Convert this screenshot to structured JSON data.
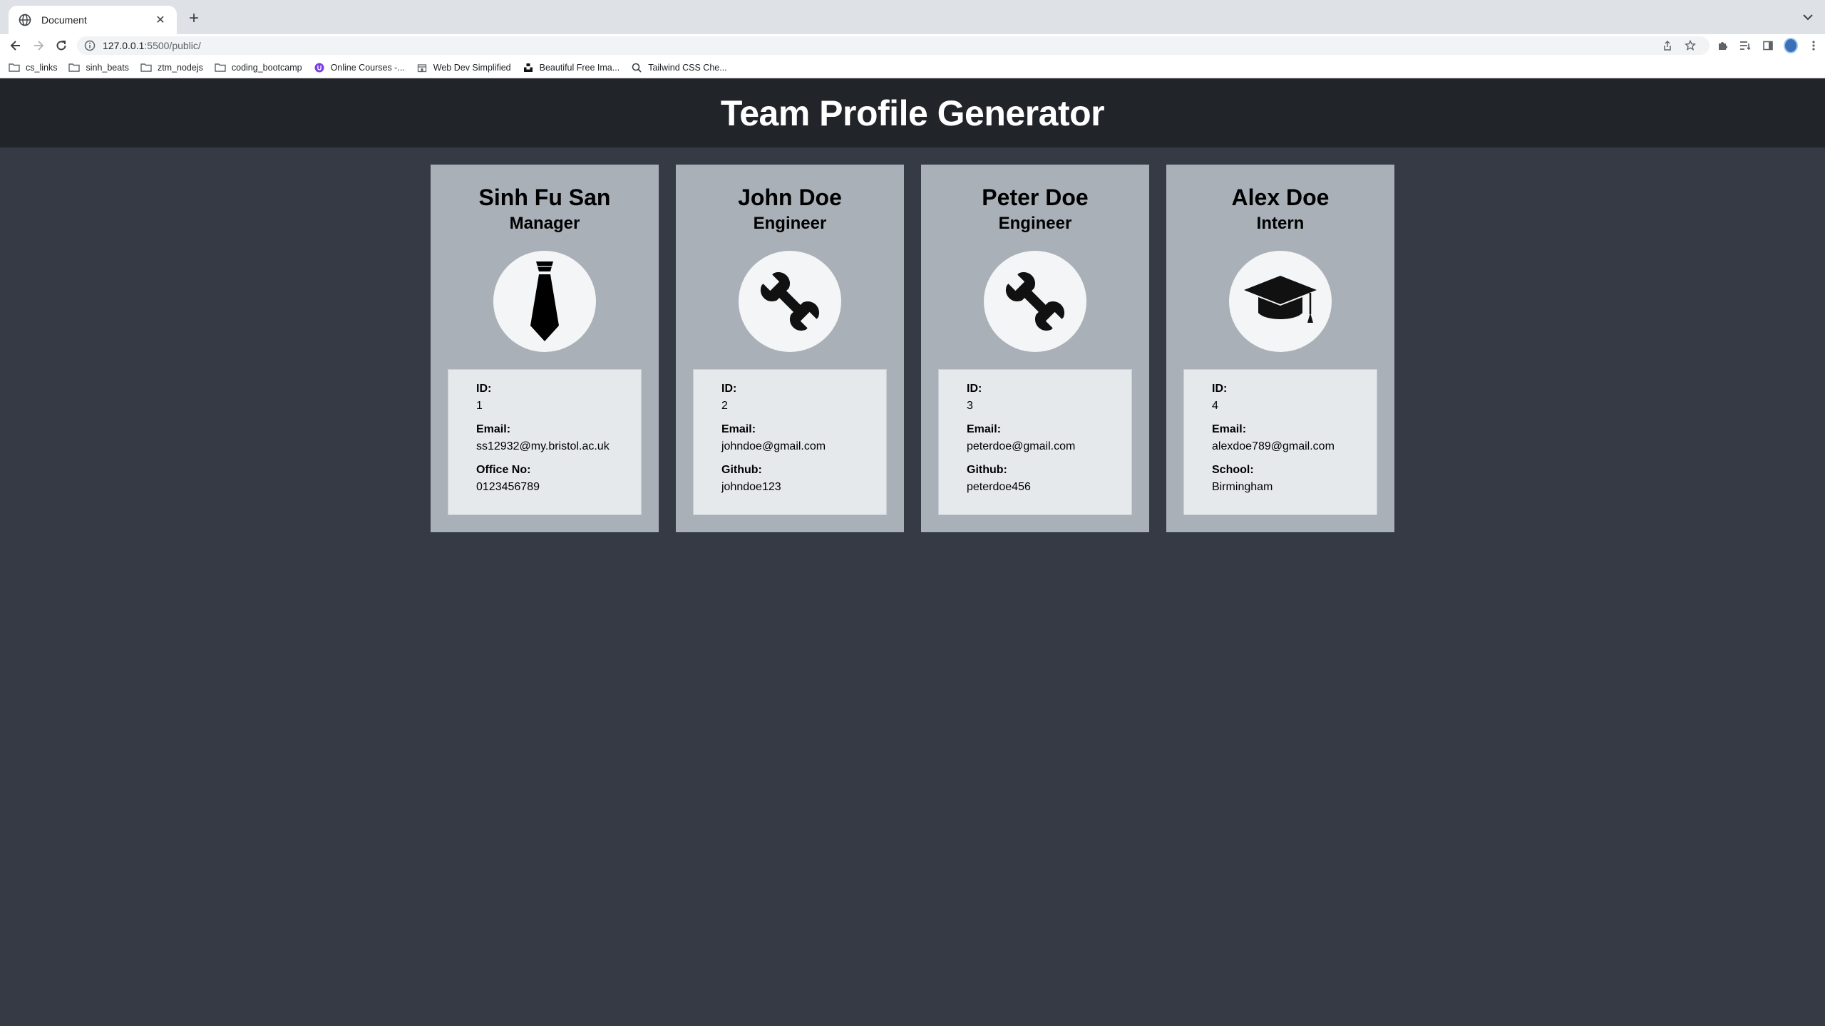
{
  "browser": {
    "tab_title": "Document",
    "url_host": "127.0.0.1",
    "url_path": ":5500/public/",
    "bookmarks": [
      {
        "label": "cs_links",
        "icon": "folder-icon"
      },
      {
        "label": "sinh_beats",
        "icon": "folder-icon"
      },
      {
        "label": "ztm_nodejs",
        "icon": "folder-icon"
      },
      {
        "label": "coding_bootcamp",
        "icon": "folder-icon"
      },
      {
        "label": "Online Courses -...",
        "icon": "course-icon"
      },
      {
        "label": "Web Dev Simplified",
        "icon": "store-icon"
      },
      {
        "label": "Beautiful Free Ima...",
        "icon": "unsplash-icon"
      },
      {
        "label": "Tailwind CSS Che...",
        "icon": "search-icon"
      }
    ]
  },
  "header": {
    "title": "Team Profile Generator"
  },
  "cards": [
    {
      "name": "Sinh Fu San",
      "role": "Manager",
      "icon": "tie-icon",
      "id_label": "ID:",
      "id": "1",
      "email_label": "Email:",
      "email": "ss12932@my.bristol.ac.uk",
      "extra_label": "Office No:",
      "extra": "0123456789"
    },
    {
      "name": "John Doe",
      "role": "Engineer",
      "icon": "wrench-icon",
      "id_label": "ID:",
      "id": "2",
      "email_label": "Email:",
      "email": "johndoe@gmail.com",
      "extra_label": "Github:",
      "extra": "johndoe123"
    },
    {
      "name": "Peter Doe",
      "role": "Engineer",
      "icon": "wrench-icon",
      "id_label": "ID:",
      "id": "3",
      "email_label": "Email:",
      "email": "peterdoe@gmail.com",
      "extra_label": "Github:",
      "extra": "peterdoe456"
    },
    {
      "name": "Alex Doe",
      "role": "Intern",
      "icon": "graduation-cap-icon",
      "id_label": "ID:",
      "id": "4",
      "email_label": "Email:",
      "email": "alexdoe789@gmail.com",
      "extra_label": "School:",
      "extra": "Birmingham"
    }
  ],
  "colors": {
    "page_bg": "#353a44",
    "header_bg": "#212429",
    "card_bg": "#a9b0b8",
    "info_bg": "#e6e9ec"
  }
}
